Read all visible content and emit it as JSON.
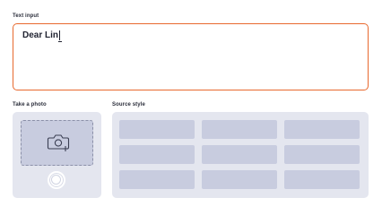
{
  "text_input": {
    "label": "Text input",
    "value": "Dear Lin"
  },
  "photo": {
    "label": "Take a photo",
    "icon": "camera-add-icon",
    "shutter_icon": "shutter-button"
  },
  "source_style": {
    "label": "Source style",
    "tile_count": 9
  },
  "colors": {
    "accent_border": "#e8692e",
    "panel_bg": "#e4e6ef",
    "tile": "#c8ccdf"
  }
}
